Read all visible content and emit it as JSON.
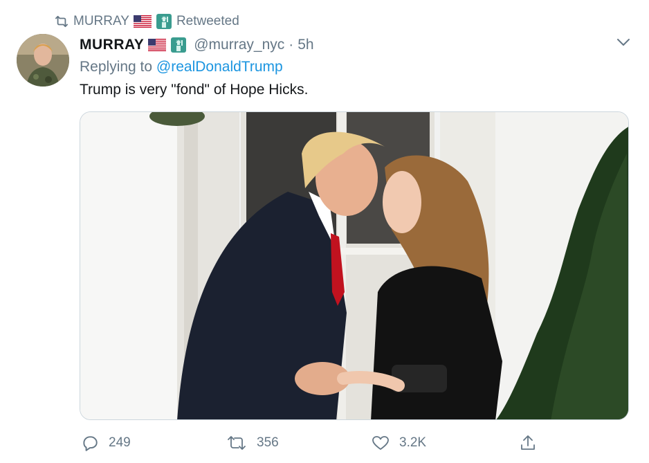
{
  "retweet_banner": {
    "icon": "retweet-icon",
    "name": "MURRAY",
    "label": "Retweeted"
  },
  "tweet": {
    "display_name": "MURRAY",
    "handle": "@murray_nyc",
    "separator": "·",
    "time": "5h",
    "replying_prefix": "Replying to ",
    "replying_to": "@realDonaldTrump",
    "text": "Trump is very \"fond\" of Hope Hicks.",
    "name_emojis": [
      "us-flag-icon",
      "statue-of-liberty-icon"
    ]
  },
  "actions": {
    "reply_count": "249",
    "retweet_count": "356",
    "like_count": "3.2K",
    "reply_icon": "reply-icon",
    "retweet_icon": "retweet-icon",
    "like_icon": "heart-icon",
    "share_icon": "share-icon"
  },
  "colors": {
    "muted": "#657786",
    "link": "#1b95e0",
    "text": "#14171a",
    "border": "#ccd6dd"
  }
}
